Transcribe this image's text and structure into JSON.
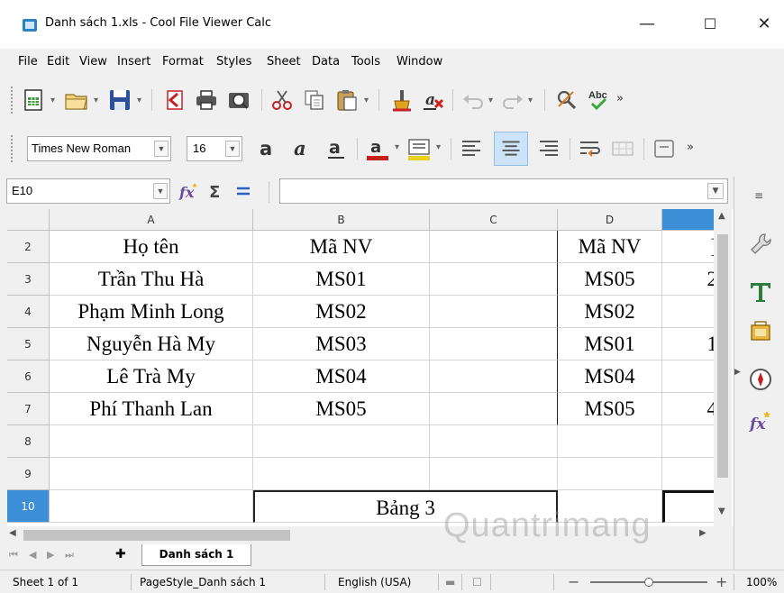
{
  "window": {
    "title": "Danh sách 1.xls - Cool File Viewer Calc",
    "minimize": "—",
    "maximize": "☐",
    "close": "✕"
  },
  "menu": [
    "File",
    "Edit",
    "View",
    "Insert",
    "Format",
    "Styles",
    "Sheet",
    "Data",
    "Tools",
    "Window"
  ],
  "format_toolbar": {
    "font_name": "Times New Roman",
    "font_size": "16",
    "chevron": "»"
  },
  "formula_bar": {
    "name_box": "E10",
    "value": ""
  },
  "columns": [
    "A",
    "B",
    "C",
    "D",
    ""
  ],
  "rows": [
    {
      "num": "2",
      "a": "Họ tên",
      "b": "Mã NV",
      "c": "",
      "d": "Mã NV",
      "e": "]"
    },
    {
      "num": "3",
      "a": "Trần Thu Hà",
      "b": "MS01",
      "c": "",
      "d": "MS05",
      "e": "2"
    },
    {
      "num": "4",
      "a": "Phạm Minh Long",
      "b": "MS02",
      "c": "",
      "d": "MS02",
      "e": ""
    },
    {
      "num": "5",
      "a": "Nguyễn Hà My",
      "b": "MS03",
      "c": "",
      "d": "MS01",
      "e": "1"
    },
    {
      "num": "6",
      "a": "Lê Trà My",
      "b": "MS04",
      "c": "",
      "d": "MS04",
      "e": ""
    },
    {
      "num": "7",
      "a": "Phí Thanh Lan",
      "b": "MS05",
      "c": "",
      "d": "MS05",
      "e": "4"
    },
    {
      "num": "8",
      "a": "",
      "b": "",
      "c": "",
      "d": "",
      "e": ""
    },
    {
      "num": "9",
      "a": "",
      "b": "",
      "c": "",
      "d": "",
      "e": ""
    },
    {
      "num": "10",
      "a": "",
      "bc": "Bảng 3",
      "d": "",
      "e": ""
    }
  ],
  "sheet_tabs": {
    "add": "✚",
    "active": "Danh sách 1"
  },
  "status": {
    "sheet": "Sheet 1 of 1",
    "page_style": "PageStyle_Danh sách 1",
    "language": "English (USA)",
    "zoom": "100%",
    "zoom_minus": "−",
    "zoom_plus": "+"
  },
  "watermark": "Quantrimang",
  "colors": {
    "selection": "#3c8fd6",
    "app_icon": "#2a83c6"
  }
}
